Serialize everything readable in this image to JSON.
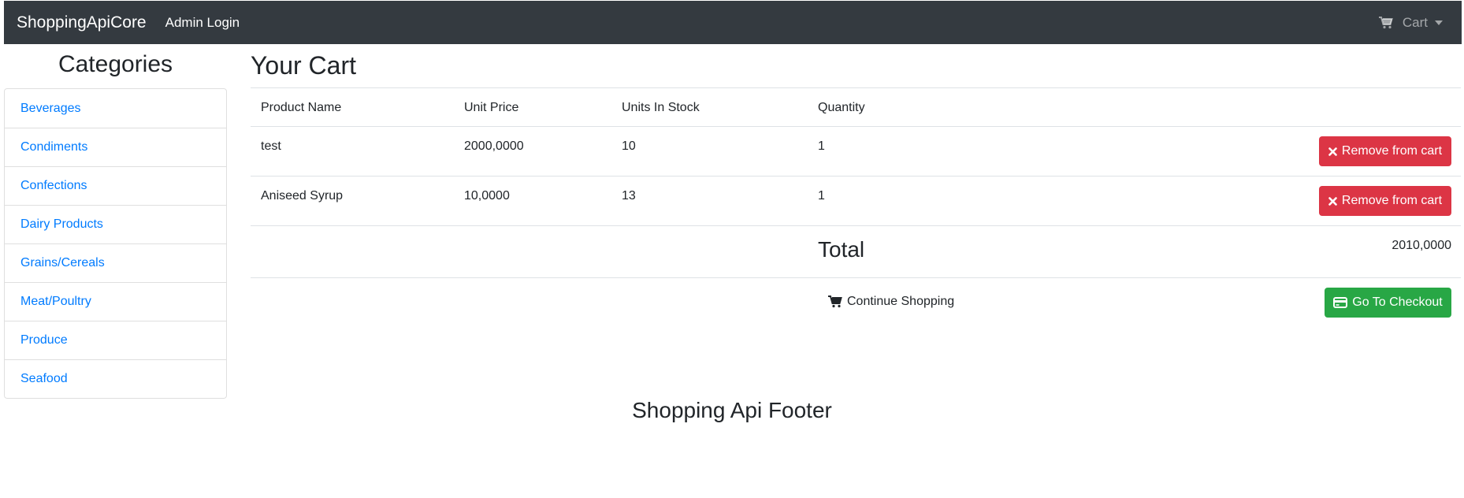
{
  "navbar": {
    "brand": "ShoppingApiCore",
    "admin_link": "Admin Login",
    "cart_label": "Cart",
    "cart_icon": "shopping-cart-icon",
    "caret_icon": "caret-down-icon"
  },
  "sidebar": {
    "title": "Categories",
    "items": [
      {
        "label": "Beverages"
      },
      {
        "label": "Condiments"
      },
      {
        "label": "Confections"
      },
      {
        "label": "Dairy Products"
      },
      {
        "label": "Grains/Cereals"
      },
      {
        "label": "Meat/Poultry"
      },
      {
        "label": "Produce"
      },
      {
        "label": "Seafood"
      }
    ],
    "link_color": "#007bff"
  },
  "cart": {
    "title": "Your Cart",
    "columns": [
      "Product Name",
      "Unit Price",
      "Units In Stock",
      "Quantity"
    ],
    "rows": [
      {
        "name": "test",
        "price": "2000,0000",
        "stock": "10",
        "qty": "1",
        "remove_label": "Remove from cart"
      },
      {
        "name": "Aniseed Syrup",
        "price": "10,0000",
        "stock": "13",
        "qty": "1",
        "remove_label": "Remove from cart"
      }
    ],
    "total_label": "Total",
    "total_value": "2010,0000",
    "continue_label": "Continue Shopping",
    "checkout_label": "Go To Checkout",
    "danger_color": "#dc3545",
    "success_color": "#28a745"
  },
  "footer": {
    "title": "Shopping Api Footer"
  }
}
